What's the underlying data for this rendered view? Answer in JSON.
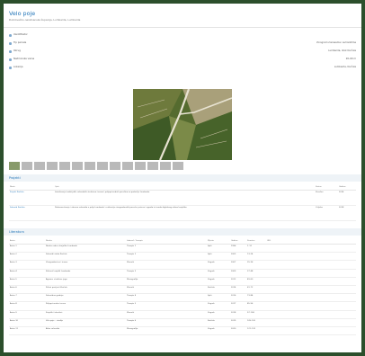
{
  "page": {
    "title": "Velo poje",
    "subtitle": "Dubrovačko-neretvanska županija, Lumbarda, Lumbarda"
  },
  "info_rows": [
    {
      "label": "Identifikator",
      "value": ""
    },
    {
      "label": "Tip parcele",
      "value": "Vinograd s terasama i suhozidima"
    },
    {
      "label": "Okrug",
      "value": "Lumbarda, otok Korčula"
    },
    {
      "label": "Nadmorska visina",
      "value": "20–60 m"
    },
    {
      "label": "Lokacija",
      "value": "Lumbarda, Korčula"
    }
  ],
  "thumbnails": [
    "photo-1",
    "photo-2",
    "photo-3",
    "photo-4",
    "photo-5",
    "photo-6",
    "photo-7",
    "photo-8",
    "photo-9",
    "photo-10",
    "photo-11",
    "photo-12",
    "photo-13",
    "photo-14"
  ],
  "projects": {
    "heading": "Projekti",
    "columns": [
      "Naziv",
      "Opis",
      "",
      "",
      "",
      "Status",
      "Godina"
    ],
    "rows": [
      {
        "name": "Projekt Korčula",
        "desc": "Istraživanje tradicijskih suhozidnih struktura, terasa i poljoprivrednih površina na području Lumbarde.",
        "status": "Završen",
        "year": "2014"
      },
      {
        "name": "Suhozid Korčula",
        "desc": "Dokumentiranje i obnova suhozida u polju Lumbarde; evidencija vinogradarskih parcela, puteva i ograda te izrada digitalnog atlasa krajolika.",
        "status": "U tijeku",
        "year": "2018"
      }
    ]
  },
  "literature": {
    "heading": "Literatura",
    "columns": [
      "Autor",
      "Naslov",
      "Izdavač / časopis",
      "Mjesto",
      "Godina",
      "Stranice",
      "URL"
    ],
    "rows": [
      {
        "author": "Autor 1",
        "title": "Naslov rada o krajoliku Lumbarde",
        "publisher": "Časopis 1",
        "place": "Split",
        "year": "1996",
        "pages": "1–12",
        "url": ""
      },
      {
        "author": "Autor 2",
        "title": "Suhozidi otoka Korčule",
        "publisher": "Časopis 2",
        "place": "Split",
        "year": "2003",
        "pages": "13–24",
        "url": ""
      },
      {
        "author": "Autor 3",
        "title": "Vinogradarstvo i terase",
        "publisher": "Zbornik",
        "place": "Zagreb",
        "year": "2007",
        "pages": "25–36",
        "url": ""
      },
      {
        "author": "Autor 4",
        "title": "Kulturni krajolik Lumbarde",
        "publisher": "Časopis 3",
        "place": "Zagreb",
        "year": "2009",
        "pages": "37–48",
        "url": ""
      },
      {
        "author": "Autor 5",
        "title": "Agrarne strukture juga",
        "publisher": "Monografija",
        "place": "Zagreb",
        "year": "2012",
        "pages": "49–60",
        "url": ""
      },
      {
        "author": "Autor 6",
        "title": "Prilozi povijesti Korčule",
        "publisher": "Zbornik",
        "place": "Korčula",
        "year": "2014",
        "pages": "61–72",
        "url": ""
      },
      {
        "author": "Autor 7",
        "title": "Suhozidna gradnja",
        "publisher": "Časopis 4",
        "place": "Split",
        "year": "2016",
        "pages": "73–84",
        "url": ""
      },
      {
        "author": "Autor 8",
        "title": "Poljoprivredne terase",
        "publisher": "Časopis 5",
        "place": "Zagreb",
        "year": "2017",
        "pages": "85–96",
        "url": ""
      },
      {
        "author": "Autor 9",
        "title": "Krajolik i identitet",
        "publisher": "Zbornik",
        "place": "Zagreb",
        "year": "2018",
        "pages": "97–108",
        "url": ""
      },
      {
        "author": "Autor 10",
        "title": "Velo poje – studija",
        "publisher": "Časopis 6",
        "place": "Korčula",
        "year": "2019",
        "pages": "109–120",
        "url": ""
      },
      {
        "author": "Autor 11",
        "title": "Atlas suhozida",
        "publisher": "Monografija",
        "place": "Zagreb",
        "year": "2020",
        "pages": "121–132",
        "url": ""
      }
    ]
  }
}
